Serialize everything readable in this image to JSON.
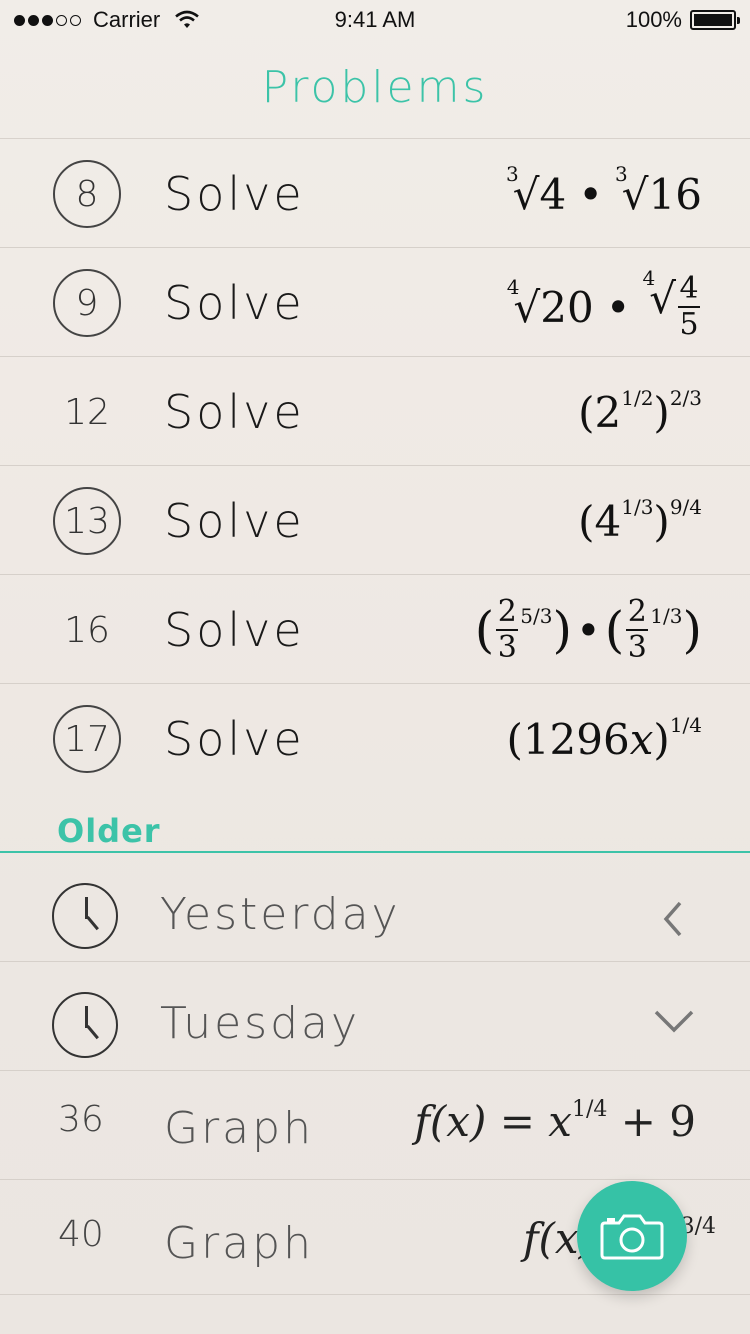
{
  "status": {
    "carrier": "Carrier",
    "time": "9:41 AM",
    "battery": "100%"
  },
  "nav": {
    "title": "Problems"
  },
  "problems": [
    {
      "num": "8",
      "circled": true,
      "action": "Solve"
    },
    {
      "num": "9",
      "circled": true,
      "action": "Solve"
    },
    {
      "num": "12",
      "circled": false,
      "action": "Solve"
    },
    {
      "num": "13",
      "circled": true,
      "action": "Solve"
    },
    {
      "num": "16",
      "circled": false,
      "action": "Solve"
    },
    {
      "num": "17",
      "circled": true,
      "action": "Solve"
    }
  ],
  "math": {
    "p8": {
      "idx1": "3",
      "rad1": "4",
      "op": "•",
      "idx2": "3",
      "rad2": "16"
    },
    "p9": {
      "idx1": "4",
      "rad1": "20",
      "op": "•",
      "idx2": "4",
      "num": "4",
      "den": "5"
    },
    "p12": {
      "base": "(2",
      "exp_inner": "1/2",
      "close": ")",
      "exp_outer": "2/3"
    },
    "p13": {
      "base": "(4",
      "exp_inner": "1/3",
      "close": ")",
      "exp_outer": "9/4"
    },
    "p16": {
      "num1": "2",
      "den1": "3",
      "exp1": "5/3",
      "op": "•",
      "num2": "2",
      "den2": "3",
      "exp2": "1/3"
    },
    "p17": {
      "base": "(1296",
      "var": "x",
      "close": " )",
      "exp": "1/4"
    }
  },
  "older": {
    "section_label": "Older",
    "groups": [
      {
        "label": "Yesterday",
        "chevron": "chevron-left"
      },
      {
        "label": "Tuesday",
        "chevron": "chevron-down"
      }
    ],
    "graphs": [
      {
        "num": "36",
        "action": "Graph",
        "lhs": "f(x) = x",
        "exp": "1/4",
        "rest": "+ 9"
      },
      {
        "num": "40",
        "action": "Graph",
        "lhs": "f(x) = x",
        "exp": "3/4",
        "rest": ""
      }
    ]
  },
  "colors": {
    "accent": "#3cc3a8",
    "fab": "#36c2a6"
  }
}
